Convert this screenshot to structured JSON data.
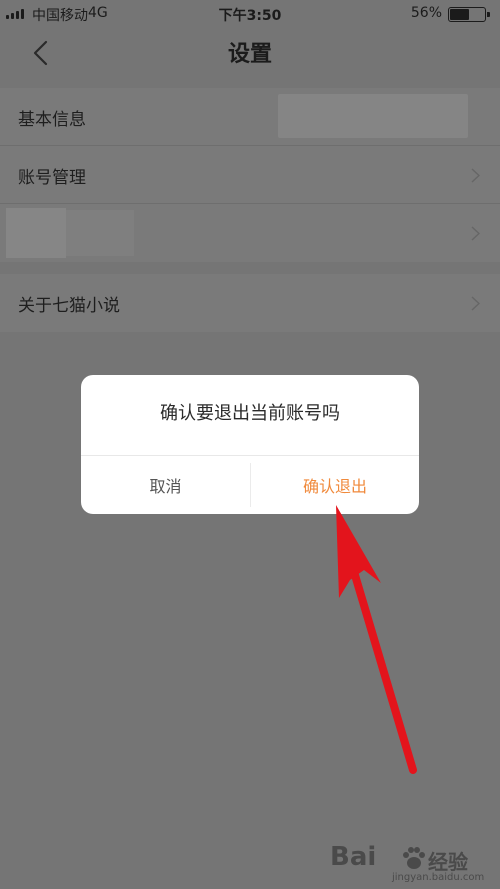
{
  "status_bar": {
    "carrier": "中国移动",
    "network": "4G",
    "time": "下午3:50",
    "battery_percent": "56%",
    "battery_level": 0.56
  },
  "nav": {
    "title": "设置",
    "back_icon": "chevron-left-icon"
  },
  "settings": {
    "group1": [
      {
        "label": "基本信息"
      },
      {
        "label": "账号管理"
      },
      {
        "label": ""
      }
    ],
    "group2": [
      {
        "label": "关于七猫小说"
      }
    ]
  },
  "dialog": {
    "message": "确认要退出当前账号吗",
    "cancel_label": "取消",
    "confirm_label": "确认退出",
    "confirm_color": "#f08a3c"
  },
  "annotation": {
    "arrow_color": "#e3141c"
  },
  "watermark": {
    "logo": "Bai",
    "word": "经验",
    "url": "jingyan.baidu.com"
  }
}
